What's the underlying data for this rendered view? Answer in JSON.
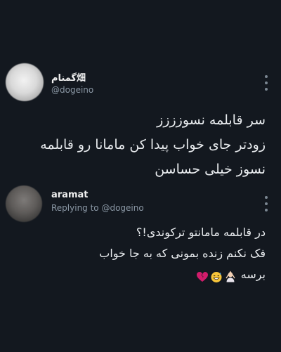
{
  "tweets": [
    {
      "name": "گمنام畑",
      "handle": "@dogeino",
      "lines": [
        "سر قابلمه نسوزززز",
        "زودتر  جای خواب پیدا کن مامانا رو قابلمه",
        "نسوز خیلی حساسن"
      ]
    },
    {
      "name": "aramat",
      "reply_to": "Replying to @dogeino",
      "lines": [
        "در قابلمه مامانتو ترکوندی!؟",
        "فک نکنم زنده بمونی که به جا خواب",
        "برسه"
      ],
      "emoji": [
        "woman-gesturing-ok-icon",
        "grinning-sweat-face-icon",
        "broken-heart-icon"
      ]
    }
  ],
  "colors": {
    "background": "#13181f",
    "text": "#e7e9ea",
    "secondary": "#8b98a5",
    "broken_heart": "#d11c6b"
  }
}
